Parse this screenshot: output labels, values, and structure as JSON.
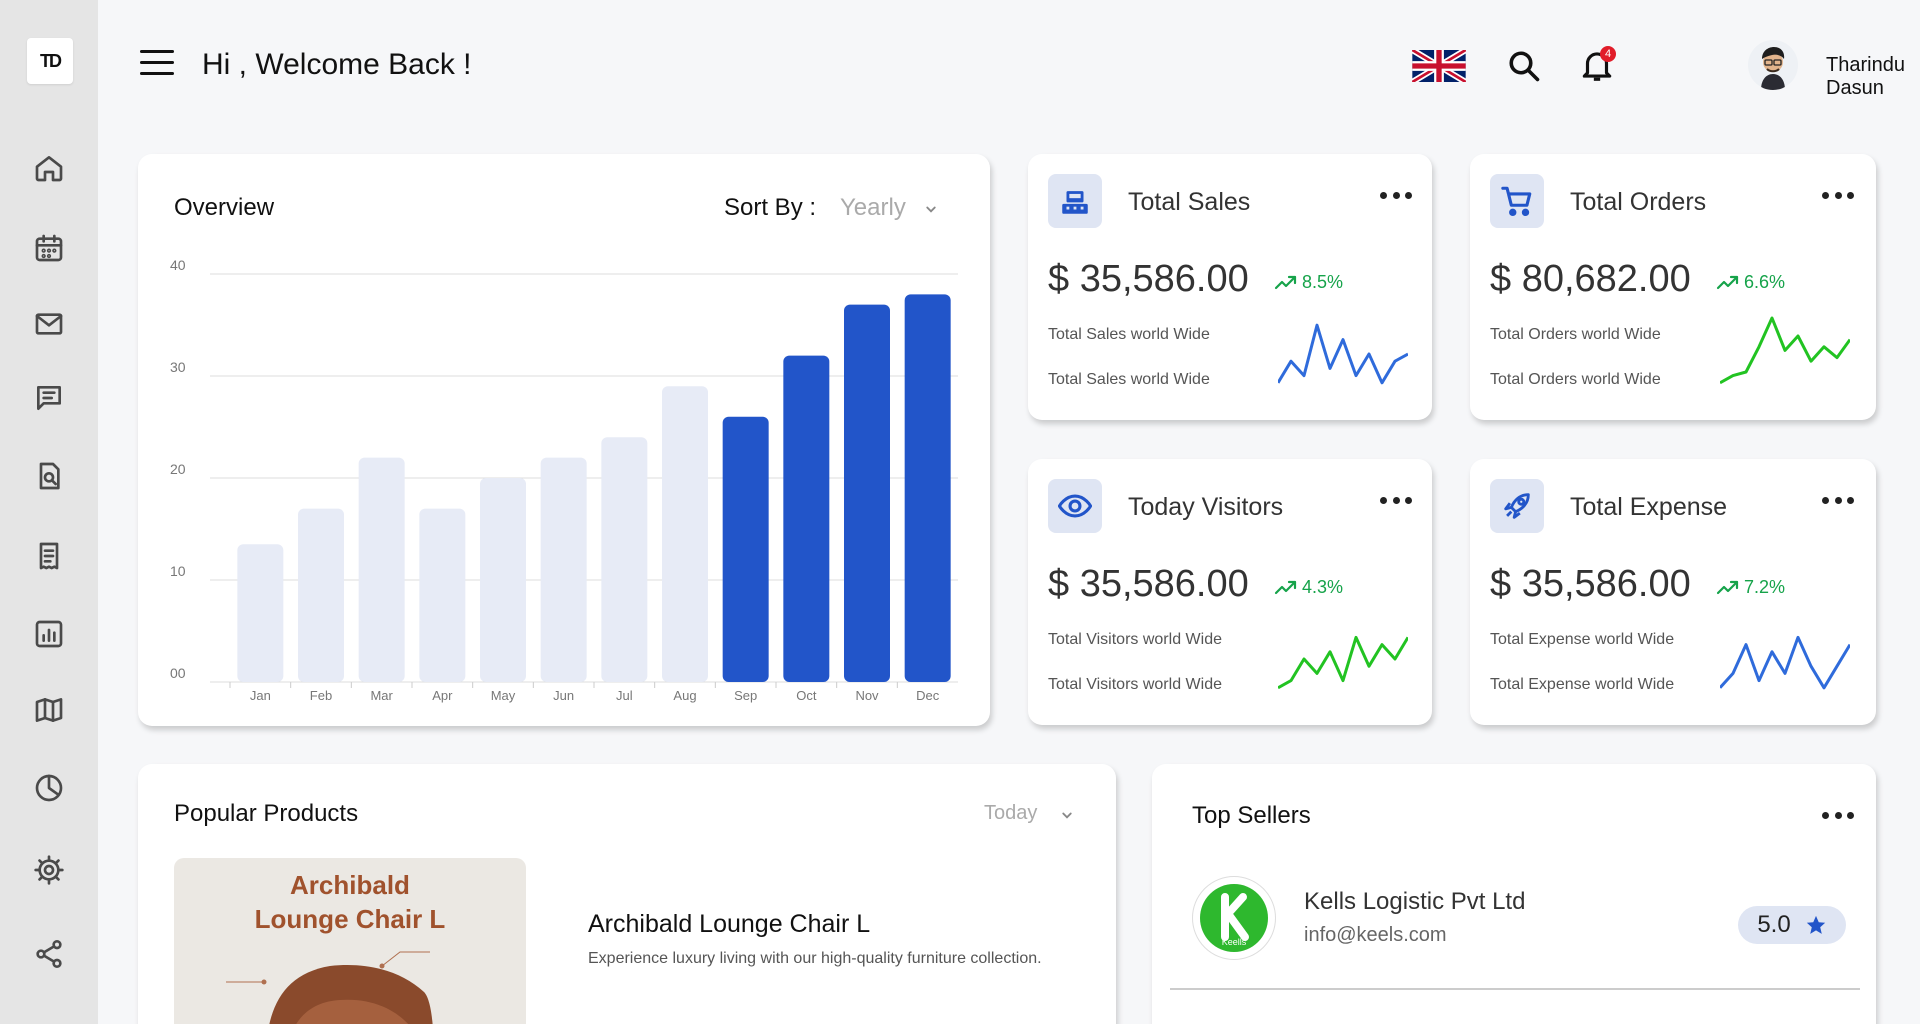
{
  "logo": {
    "text": "TD"
  },
  "header": {
    "welcome": "Hi , Welcome Back !",
    "notification_count": "4",
    "username": "Tharindu Dasun"
  },
  "overview": {
    "title": "Overview",
    "sort_label": "Sort By :",
    "sort_value": "Yearly"
  },
  "chart_data": {
    "type": "bar",
    "categories": [
      "Jan",
      "Feb",
      "Mar",
      "Apr",
      "May",
      "Jun",
      "Jul",
      "Aug",
      "Sep",
      "Oct",
      "Nov",
      "Dec"
    ],
    "values": [
      13.5,
      17,
      22,
      17,
      20,
      22,
      24,
      29,
      26,
      32,
      37,
      38
    ],
    "highlighted": [
      false,
      false,
      false,
      false,
      false,
      false,
      false,
      false,
      true,
      true,
      true,
      true
    ],
    "yticks": [
      "00",
      "10",
      "20",
      "30",
      "40"
    ],
    "ylim": [
      0,
      40
    ],
    "colors": {
      "muted": "#e7ebf6",
      "active": "#2255c9"
    },
    "grid": true
  },
  "stats": [
    {
      "title": "Total Sales",
      "value": "$ 35,586.00",
      "trend": "8.5%",
      "sub1": "Total Sales world Wide",
      "sub2": "Total Sales world Wide",
      "icon": "cash-register-icon",
      "spark_color": "#2f6bdb",
      "spark": [
        10,
        40,
        20,
        90,
        30,
        70,
        20,
        50,
        10,
        40,
        50
      ]
    },
    {
      "title": "Total Orders",
      "value": "$ 80,682.00",
      "trend": "6.6%",
      "sub1": "Total Orders world Wide",
      "sub2": "Total Orders world Wide",
      "icon": "cart-icon",
      "spark_color": "#22c322",
      "spark": [
        10,
        20,
        25,
        60,
        100,
        55,
        75,
        40,
        60,
        45,
        70
      ]
    },
    {
      "title": "Today Visitors",
      "value": "$ 35,586.00",
      "trend": "4.3%",
      "sub1": "Total Visitors world Wide",
      "sub2": "Total Visitors world Wide",
      "icon": "eye-icon",
      "spark_color": "#22c322",
      "spark": [
        10,
        20,
        50,
        30,
        60,
        20,
        80,
        40,
        70,
        50,
        80
      ]
    },
    {
      "title": "Total Expense",
      "value": "$ 35,586.00",
      "trend": "7.2%",
      "sub1": "Total Expense world Wide",
      "sub2": "Total Expense world Wide",
      "icon": "rocket-icon",
      "spark_color": "#2f6bdb",
      "spark": [
        10,
        30,
        70,
        20,
        60,
        30,
        80,
        40,
        10,
        40,
        70
      ]
    }
  ],
  "popular": {
    "title": "Popular Products",
    "filter": "Today",
    "image_title_line1": "Archibald",
    "image_title_line2": "Lounge Chair L",
    "product_name": "Archibald Lounge Chair L",
    "product_desc": "Experience luxury living with our high-quality furniture collection."
  },
  "sellers": {
    "title": "Top Sellers",
    "items": [
      {
        "name": "Kells Logistic Pvt Ltd",
        "email": "info@keels.com",
        "rating": "5.0",
        "logo_text": "Keells"
      }
    ]
  }
}
